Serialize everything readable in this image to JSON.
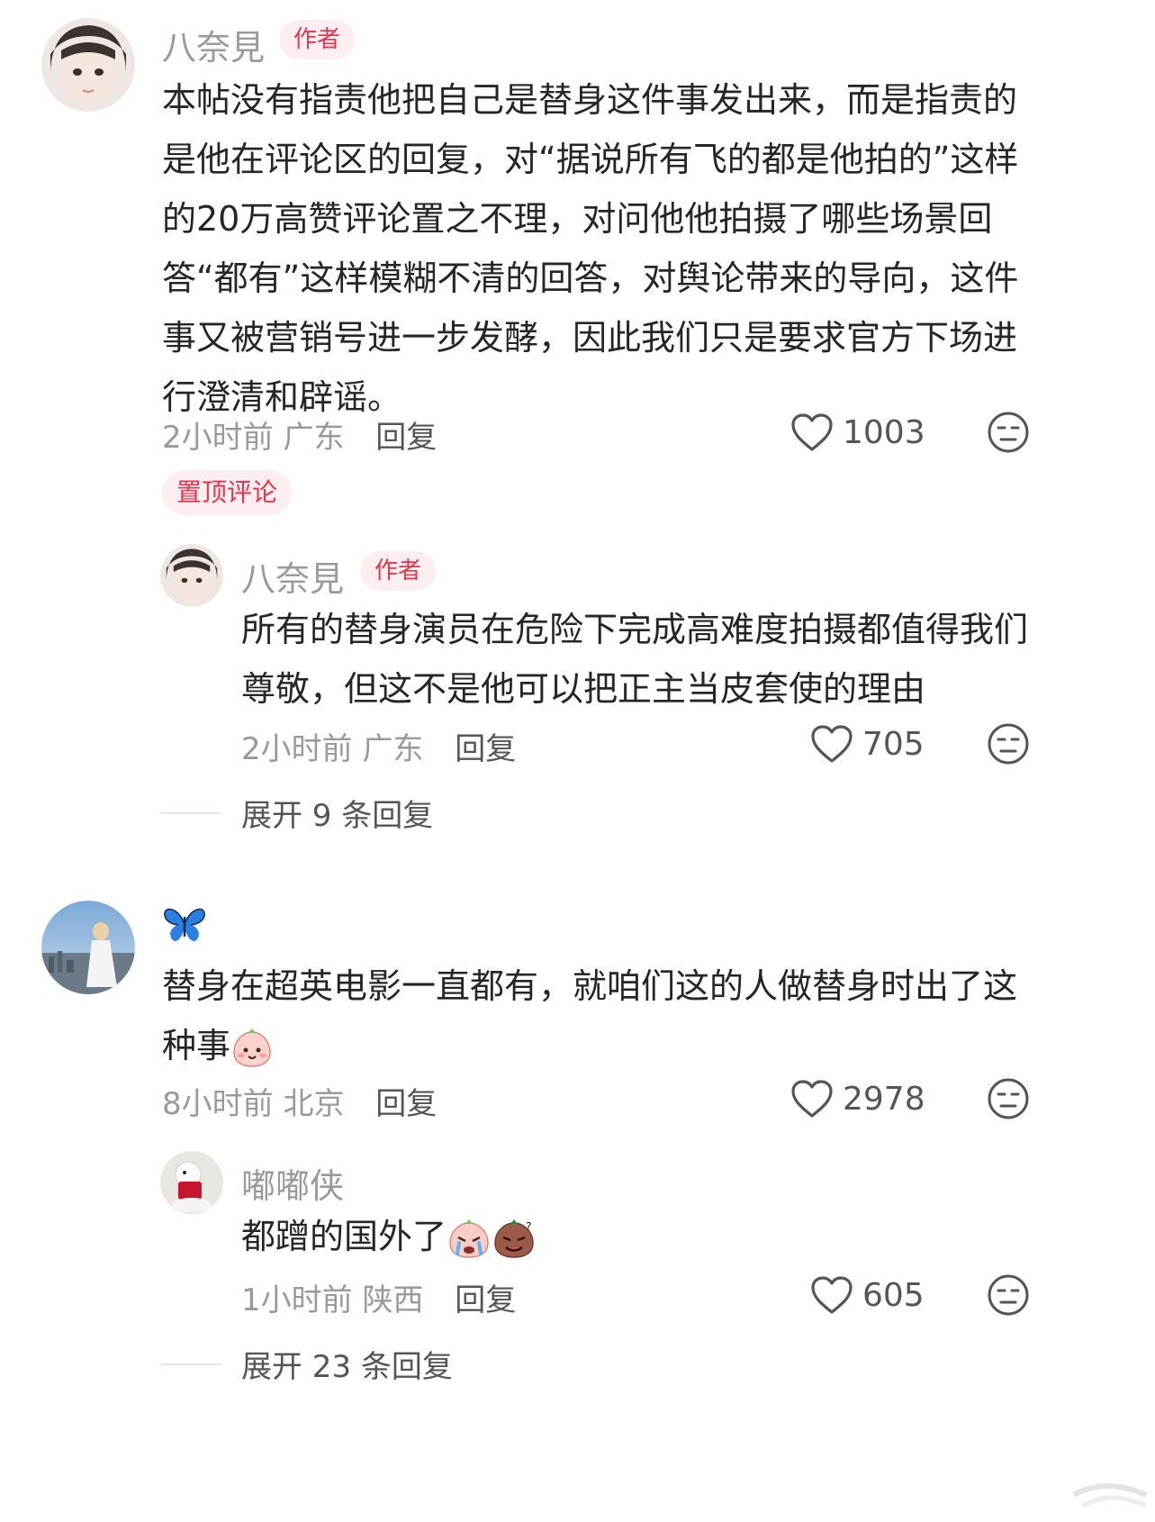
{
  "comment1": {
    "username": "八奈見",
    "badge": "作者",
    "text": "本帖没有指责他把自己是替身这件事发出来，而是指责的是他在评论区的回复，对“据说所有飞的都是他拍的”这样的20万高赞评论置之不理，对问他他拍摄了哪些场景回答“都有”这样模糊不清的回答，对舆论带来的导向，这件事又被营销号进一步发酵，因此我们只是要求官方下场进行澄清和辟谣。",
    "time": "2小时前",
    "location": "广东",
    "reply_label": "回复",
    "likes": "1003",
    "pinned_label": "置顶评论",
    "reply": {
      "username": "八奈見",
      "badge": "作者",
      "text": "所有的替身演员在危险下完成高难度拍摄都值得我们尊敬，但这不是他可以把正主当皮套使的理由",
      "time": "2小时前",
      "location": "广东",
      "reply_label": "回复",
      "likes": "705"
    },
    "expand_label": "展开 9 条回复"
  },
  "comment2": {
    "username": "🦋",
    "text": "替身在超英电影一直都有，就咱们这的人做替身时出了这种事",
    "time": "8小时前",
    "location": "北京",
    "reply_label": "回复",
    "likes": "2978",
    "reply": {
      "username": "嘟嘟侠",
      "text": "都蹭的国外了",
      "time": "1小时前",
      "location": "陕西",
      "reply_label": "回复",
      "likes": "605"
    },
    "expand_label": "展开 23 条回复"
  },
  "icons": {
    "like": "heart-outline-icon",
    "mood": "meh-face-icon"
  },
  "colors": {
    "badge_text": "#e6344f",
    "badge_bg": "#fdeef0",
    "meta": "#9a9a9a"
  }
}
